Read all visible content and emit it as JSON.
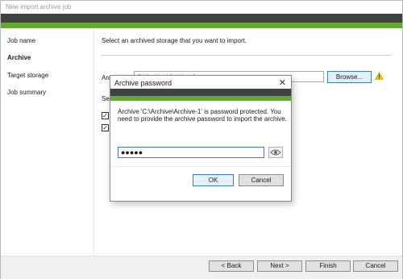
{
  "window": {
    "title": "New import archive job"
  },
  "sidebar": {
    "items": [
      {
        "label": "Job name",
        "active": false
      },
      {
        "label": "Archive",
        "active": true
      },
      {
        "label": "Target storage",
        "active": false
      },
      {
        "label": "Job summary",
        "active": false
      }
    ]
  },
  "main": {
    "instruction": "Select an archived storage that you want to import.",
    "archive_label_partial": "Archi",
    "path_value": "C:\\Archive\\Archive-1",
    "browse_label": "Browse...",
    "select_label_partial": "Sele",
    "checkbox_mark": "✓"
  },
  "footer": {
    "back_label": "< Back",
    "next_label": "Next >",
    "finish_label": "Finish",
    "cancel_label": "Cancel"
  },
  "dialog": {
    "title": "Archive password",
    "close_glyph": "✕",
    "message": "Archive 'C:\\Archive\\Archive-1' is password protected. You need to provide the archive password to import the archive.",
    "password_mask": "●●●●●",
    "ok_label": "OK",
    "cancel_label": "Cancel"
  },
  "colors": {
    "band_dark": "#3f4242",
    "band_green": "#64a732",
    "focus_blue": "#3b7bd4",
    "warning": "#f2c200"
  }
}
